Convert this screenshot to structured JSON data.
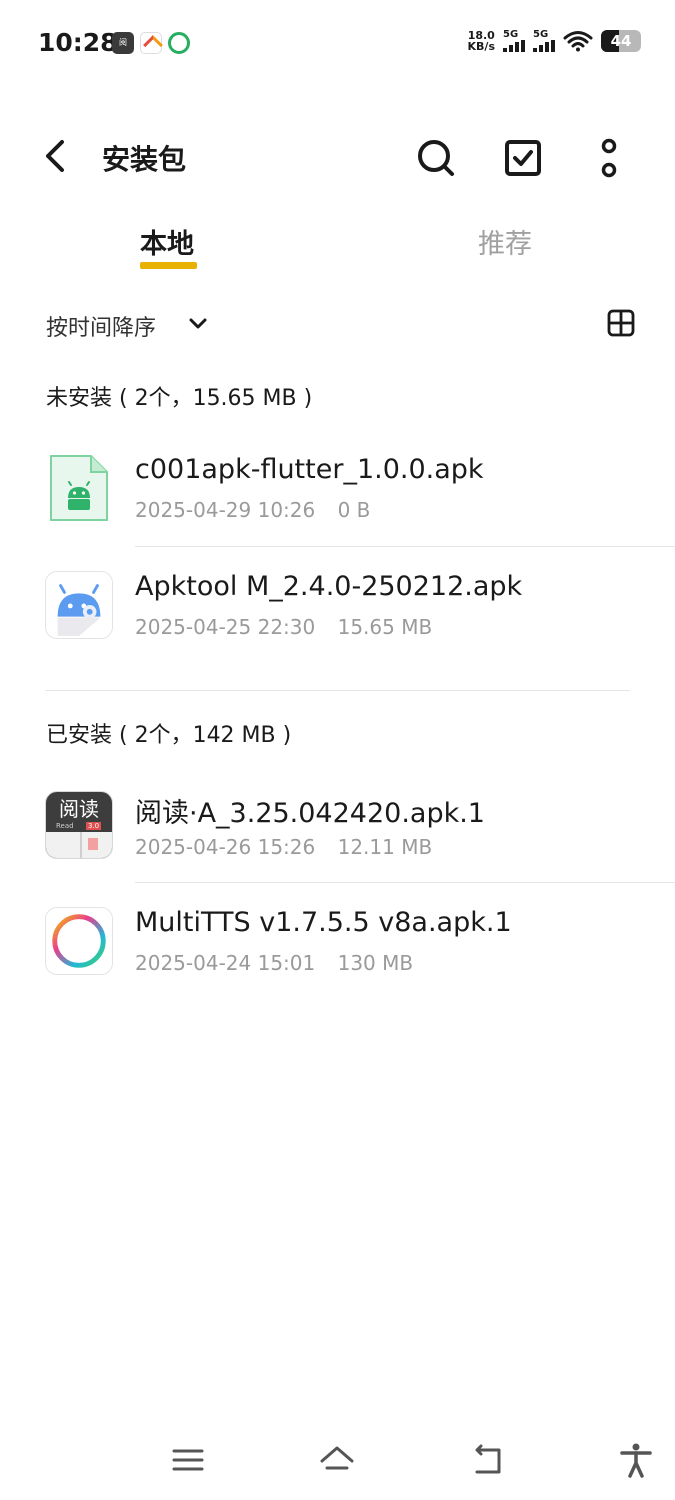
{
  "status_bar": {
    "time": "10:28",
    "net_speed_value": "18.0",
    "net_speed_unit": "KB/s",
    "sim1_label": "5G",
    "sim2_label": "5G",
    "battery_level": "44",
    "app_icons": [
      "read-app-icon",
      "kuai-app-icon",
      "tts-app-icon"
    ]
  },
  "header": {
    "title": "安装包",
    "icons": [
      "back-arrow-icon",
      "search-icon",
      "select-checkbox-icon",
      "more-options-icon"
    ]
  },
  "tabs": [
    {
      "label": "本地",
      "active": true
    },
    {
      "label": "推荐",
      "active": false
    }
  ],
  "sort": {
    "label": "按时间降序",
    "icons": [
      "chevron-down-icon",
      "grid-view-icon"
    ]
  },
  "sections": {
    "not_installed": {
      "title": "未安装 ( 2个，15.65 MB )",
      "items": [
        {
          "name": "c001apk-flutter_1.0.0.apk",
          "date": "2025-04-29 10:26",
          "size": "0 B",
          "icon": "android-apk-icon"
        },
        {
          "name": "Apktool M_2.4.0-250212.apk",
          "date": "2025-04-25 22:30",
          "size": "15.65 MB",
          "icon": "apktool-icon"
        }
      ]
    },
    "installed": {
      "title": "已安装 ( 2个，142 MB )",
      "items": [
        {
          "name": "阅读·A_3.25.042420.apk.1",
          "date": "2025-04-26 15:26",
          "size": "12.11 MB",
          "icon": "read-app-icon",
          "icon_text": "阅读",
          "icon_sub": "Read",
          "icon_ver": "3.0"
        },
        {
          "name": "MultiTTS v1.7.5.5 v8a.apk.1",
          "date": "2025-04-24 15:01",
          "size": "130 MB",
          "icon": "multitts-icon"
        }
      ]
    }
  },
  "nav_bar": {
    "icons": [
      "menu-icon",
      "home-icon",
      "back-icon",
      "accessibility-icon"
    ]
  },
  "colors": {
    "accent": "#e8b100",
    "text_primary": "#1a1a1a",
    "text_secondary": "#9a9a9a",
    "tab_inactive": "#a0a0a0",
    "divider": "#e6e6e6"
  }
}
